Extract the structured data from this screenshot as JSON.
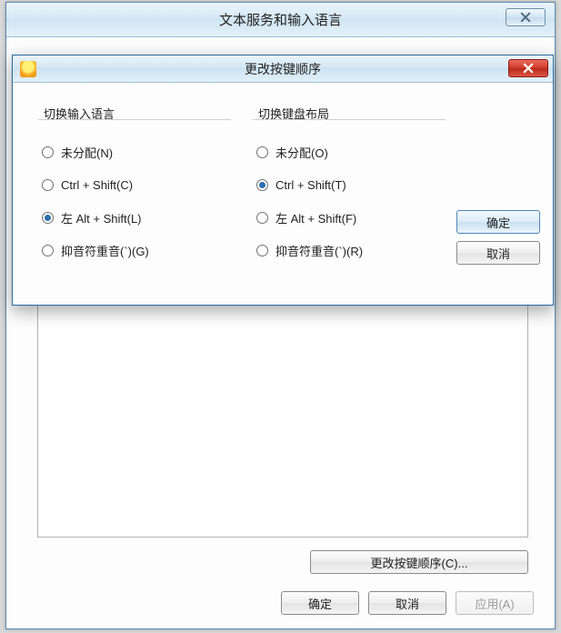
{
  "mainWindow": {
    "title": "文本服务和输入语言",
    "changeKeySequenceBtn": "更改按键顺序(C)...",
    "okBtn": "确定",
    "cancelBtn": "取消",
    "applyBtn": "应用(A)"
  },
  "modal": {
    "title": "更改按键顺序",
    "okBtn": "确定",
    "cancelBtn": "取消",
    "groupLeft": {
      "label": "切换输入语言",
      "selected": 2,
      "options": [
        "未分配(N)",
        "Ctrl + Shift(C)",
        "左 Alt + Shift(L)",
        "抑音符重音(`)(G)"
      ]
    },
    "groupRight": {
      "label": "切换键盘布局",
      "selected": 1,
      "options": [
        "未分配(O)",
        "Ctrl + Shift(T)",
        "左 Alt + Shift(F)",
        "抑音符重音(`)(R)"
      ]
    }
  }
}
